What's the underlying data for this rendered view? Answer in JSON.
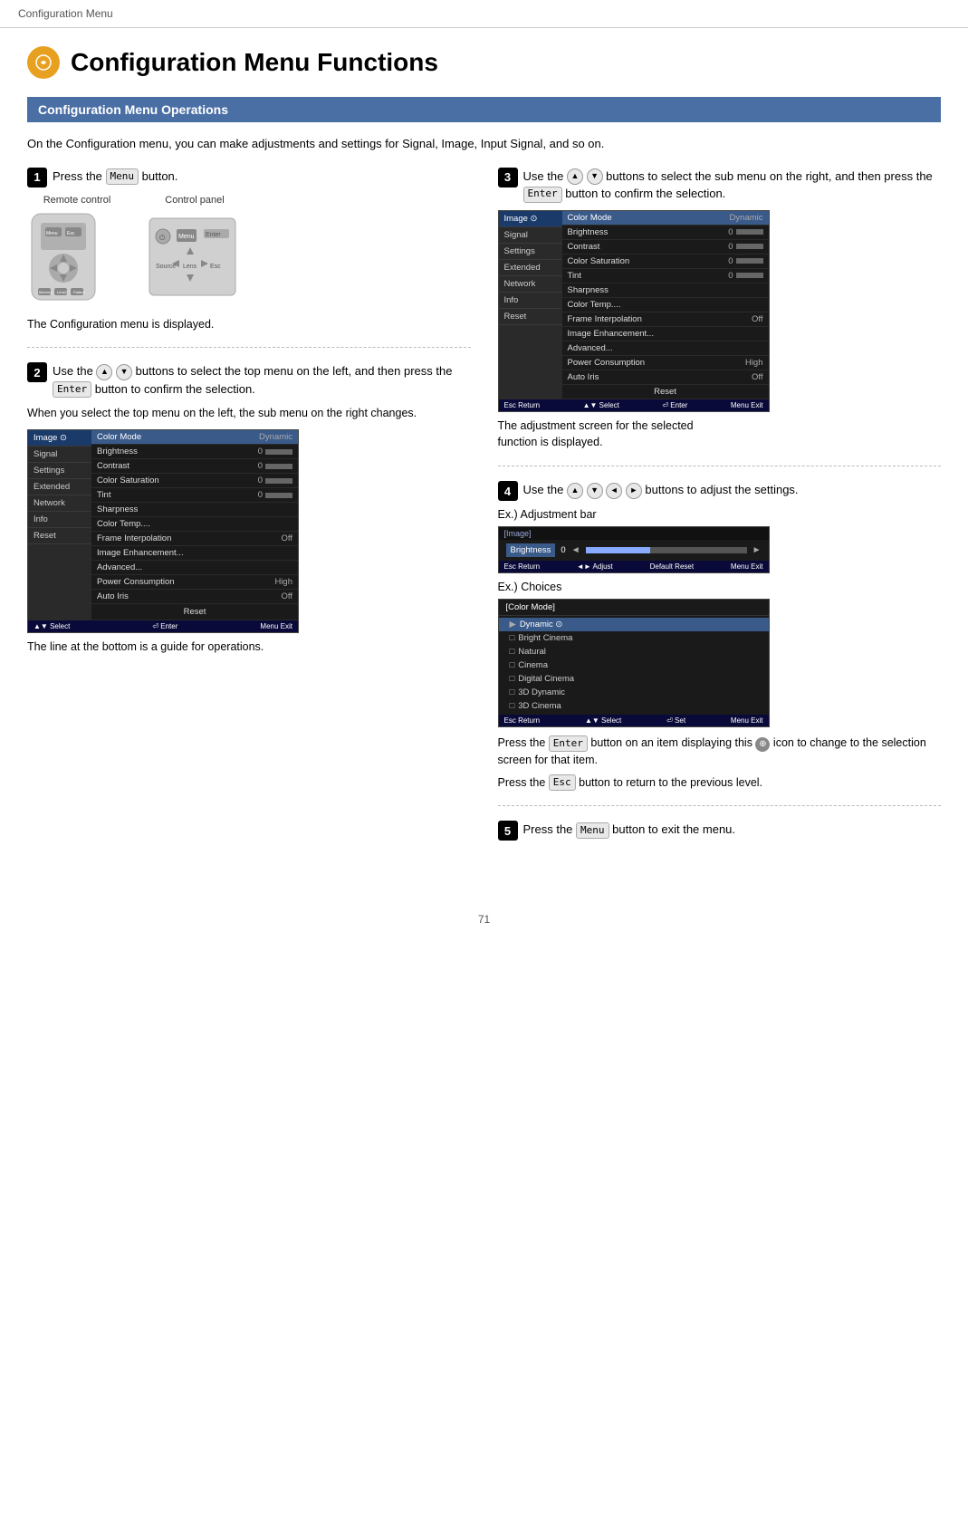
{
  "header": {
    "title": "Configuration Menu"
  },
  "page": {
    "title": "Configuration Menu Functions",
    "section_title": "Configuration Menu Operations",
    "intro": "On the Configuration menu, you can make adjustments and settings for Signal, Image, Input Signal, and so on."
  },
  "steps": {
    "step1": {
      "number": "1",
      "text_pre": "Press the",
      "key": "Menu",
      "text_post": "button.",
      "label_remote": "Remote control",
      "label_panel": "Control panel",
      "caption": "The Configuration menu is displayed."
    },
    "step2": {
      "number": "2",
      "text": "Use the",
      "text_mid": "buttons to select the top menu on the left, and then press the",
      "key_enter": "Enter",
      "text_end": "button to confirm the selection.",
      "note": "When you select the top menu on the left, the sub menu on the right changes.",
      "caption": "The line at the bottom is a guide for operations."
    },
    "step3": {
      "number": "3",
      "text": "Use the",
      "text_mid": "buttons to select the sub menu on the right, and then press the",
      "key_enter": "Enter",
      "text_end": "button to confirm the selection.",
      "caption1": "The adjustment screen for the selected",
      "caption2": "function is displayed."
    },
    "step4": {
      "number": "4",
      "text": "Use the",
      "text_end": "buttons to adjust the settings.",
      "ex_bar": "Ex.) Adjustment bar",
      "ex_choices": "Ex.) Choices",
      "note1_pre": "Press the",
      "note1_key": "Enter",
      "note1_mid": "button on an item displaying this",
      "note1_icon": "⊕",
      "note1_end": "icon to change to the selection screen for that item.",
      "note2_pre": "Press the",
      "note2_key": "Esc",
      "note2_end": "button to return to the previous level."
    },
    "step5": {
      "number": "5",
      "text_pre": "Press the",
      "key": "Menu",
      "text_post": "button to exit the menu."
    }
  },
  "menu_data": {
    "left_items": [
      "Image",
      "Signal",
      "Settings",
      "Extended",
      "Network",
      "Info",
      "Reset"
    ],
    "right_items": [
      {
        "label": "Color Mode",
        "value": "Dynamic",
        "bar": false
      },
      {
        "label": "Brightness",
        "value": "0",
        "bar": true
      },
      {
        "label": "Contrast",
        "value": "0",
        "bar": true
      },
      {
        "label": "Color Saturation",
        "value": "0",
        "bar": true
      },
      {
        "label": "Tint",
        "value": "0",
        "bar": true
      },
      {
        "label": "Sharpness",
        "value": "",
        "bar": false
      },
      {
        "label": "Color Temp....",
        "value": "",
        "bar": false
      },
      {
        "label": "Frame Interpolation",
        "value": "Off",
        "bar": false
      },
      {
        "label": "Image Enhancement...",
        "value": "",
        "bar": false
      },
      {
        "label": "Advanced...",
        "value": "",
        "bar": false
      },
      {
        "label": "Power Consumption",
        "value": "High",
        "bar": false
      },
      {
        "label": "Auto Iris",
        "value": "Off",
        "bar": false
      }
    ],
    "bottom_bar_select": "Select",
    "bottom_bar_enter": "Enter",
    "bottom_bar_exit": "Exit",
    "reset_label": "Reset"
  },
  "adj_bar_data": {
    "section_label": "[Image]",
    "item_label": "Brightness",
    "value": "0",
    "bottom_return": "Return",
    "bottom_adjust": "Adjust",
    "bottom_reset": "Reset",
    "bottom_exit": "Exit"
  },
  "choices_data": {
    "title": "[Color Mode]",
    "items": [
      "Dynamic",
      "Bright Cinema",
      "Natural",
      "Cinema",
      "Digital Cinema",
      "3D Dynamic",
      "3D Cinema"
    ],
    "selected_index": 0,
    "bottom_return": "Return",
    "bottom_select": "Select",
    "bottom_set": "Set",
    "bottom_exit": "Exit"
  },
  "footer": {
    "page_number": "71"
  }
}
